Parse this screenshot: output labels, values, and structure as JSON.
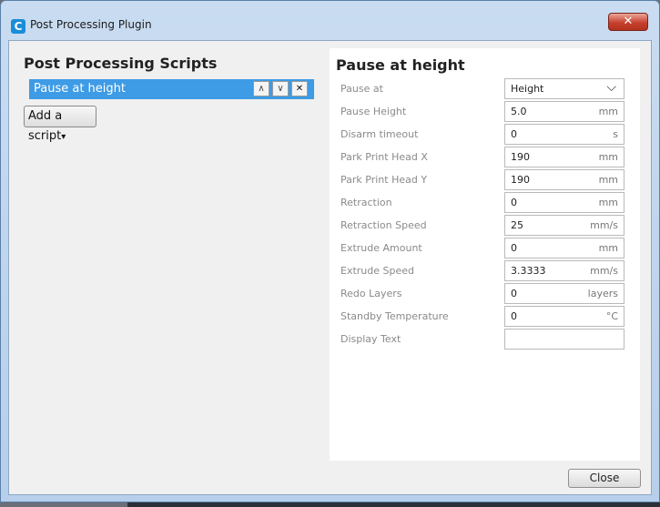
{
  "window": {
    "title": "Post Processing Plugin",
    "close_glyph": "✕"
  },
  "left": {
    "title": "Post Processing Scripts",
    "scripts": [
      {
        "label": "Pause at height"
      }
    ],
    "add_script_label": "Add a script",
    "add_script_arrow": "▾"
  },
  "right": {
    "title": "Pause at height",
    "pause_at": {
      "label": "Pause at",
      "value": "Height"
    },
    "fields": [
      {
        "label": "Pause Height",
        "value": "5.0",
        "unit": "mm"
      },
      {
        "label": "Disarm timeout",
        "value": "0",
        "unit": "s"
      },
      {
        "label": "Park Print Head X",
        "value": "190",
        "unit": "mm"
      },
      {
        "label": "Park Print Head Y",
        "value": "190",
        "unit": "mm"
      },
      {
        "label": "Retraction",
        "value": "0",
        "unit": "mm"
      },
      {
        "label": "Retraction Speed",
        "value": "25",
        "unit": "mm/s"
      },
      {
        "label": "Extrude Amount",
        "value": "0",
        "unit": "mm"
      },
      {
        "label": "Extrude Speed",
        "value": "3.3333",
        "unit": "mm/s"
      },
      {
        "label": "Redo Layers",
        "value": "0",
        "unit": "layers"
      },
      {
        "label": "Standby Temperature",
        "value": "0",
        "unit": "°C"
      },
      {
        "label": "Display Text",
        "value": "",
        "unit": ""
      }
    ]
  },
  "footer": {
    "close_label": "Close"
  },
  "icons": {
    "app": "cura-logo-icon",
    "up": "chevron-up-icon",
    "down": "chevron-down-icon",
    "remove": "close-icon"
  },
  "colors": {
    "selection": "#3e9be5",
    "window_close": "#c7402d"
  }
}
